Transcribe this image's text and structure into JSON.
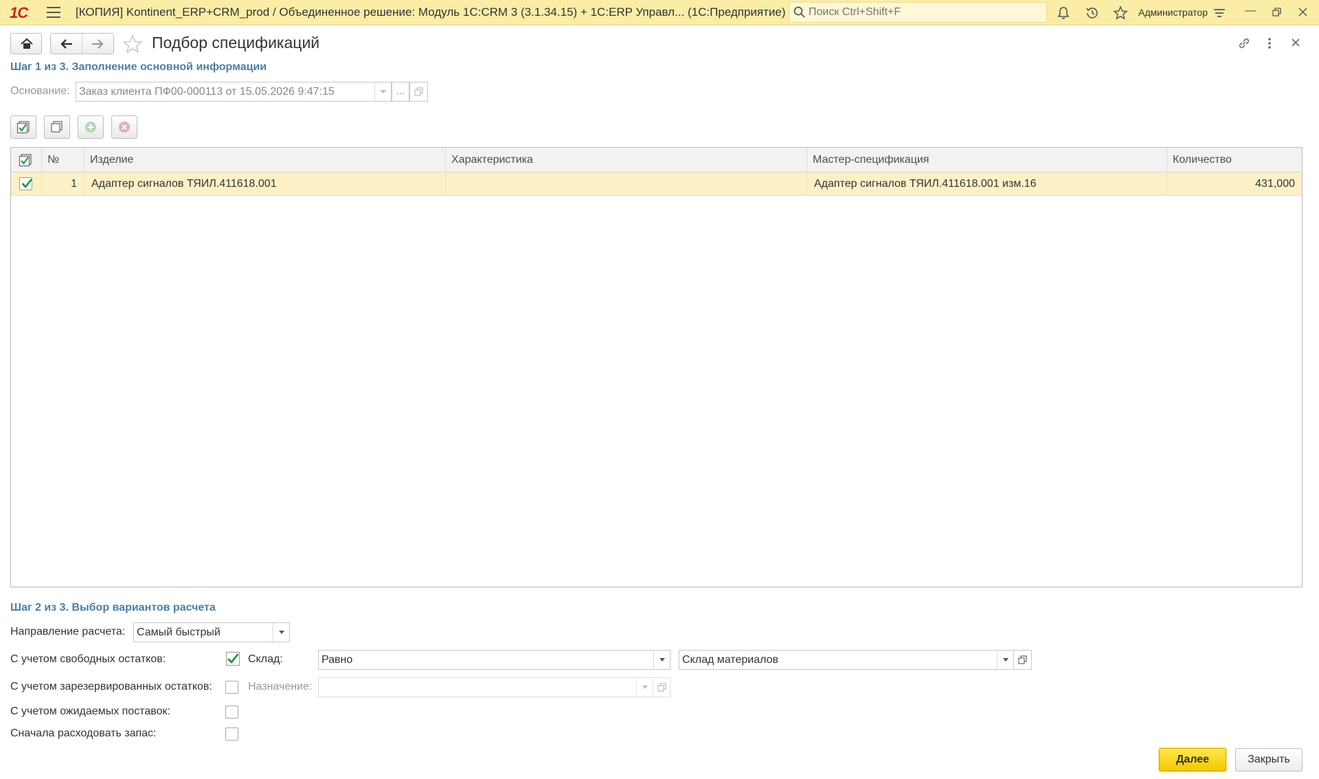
{
  "titlebar": {
    "logo": "1С",
    "app_title": "[КОПИЯ] Kontinent_ERP+CRM_prod / Объединенное решение: Модуль 1С:CRM 3 (3.1.34.15) +  1С:ERP Управл...  (1С:Предприятие)",
    "search_placeholder": "Поиск Ctrl+Shift+F",
    "user": "Администратор"
  },
  "form": {
    "title": "Подбор спецификаций"
  },
  "step1": {
    "title": "Шаг 1 из 3. Заполнение основной информации",
    "basis_label": "Основание:",
    "basis_value": "Заказ клиента ПФ00-000113 от 15.05.2026 9:47:15",
    "more_button": "..."
  },
  "table": {
    "columns": [
      "№",
      "Изделие",
      "Характеристика",
      "Мастер-спецификация",
      "Количество"
    ],
    "rows": [
      {
        "checked": true,
        "number": "1",
        "product": "Адаптер сигналов ТЯИЛ.411618.001",
        "characteristic": "",
        "master_spec": "Адаптер сигналов ТЯИЛ.411618.001 изм.16",
        "quantity": "431,000"
      }
    ]
  },
  "step2": {
    "title": "Шаг 2 из 3. Выбор вариантов расчета",
    "direction_label": "Направление расчета:",
    "direction_value": "Самый быстрый",
    "free_stock_label": "С учетом свободных остатков:",
    "free_stock_checked": true,
    "warehouse_label": "Склад:",
    "warehouse_condition": "Равно",
    "warehouse_value": "Склад материалов",
    "reserved_label": "С учетом зарезервированных остатков:",
    "reserved_checked": false,
    "purpose_label": "Назначение:",
    "purpose_value": "",
    "expected_label": "С учетом ожидаемых поставок:",
    "expected_checked": false,
    "reserve_first_label": "Сначала расходовать запас:",
    "reserve_first_checked": false
  },
  "buttons": {
    "next": "Далее",
    "close": "Закрыть"
  },
  "colors": {
    "titlebar": "#fbeda6",
    "accent_step": "#4b7fa6",
    "selected_row": "#fbf0c6",
    "primary_button": "#f5d000"
  }
}
